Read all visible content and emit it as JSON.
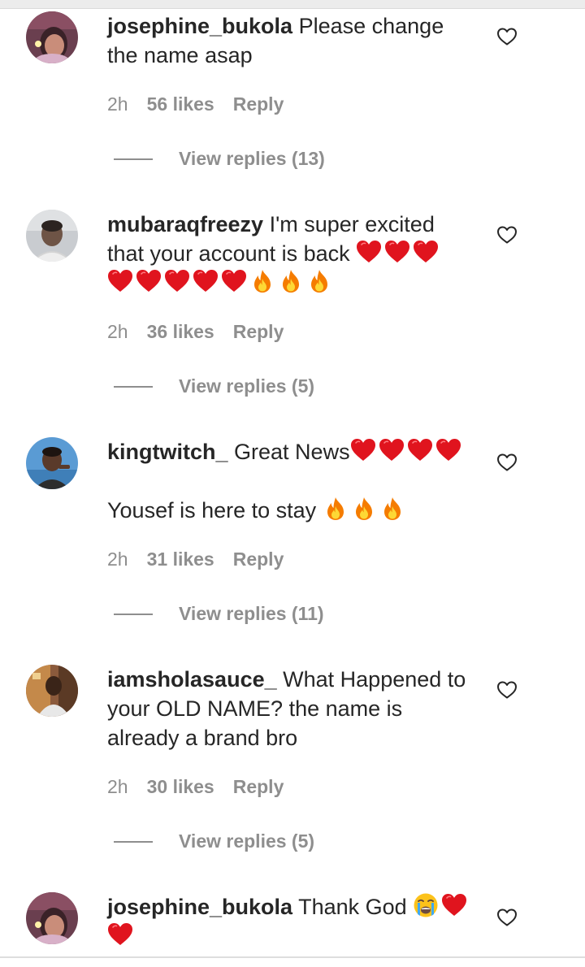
{
  "comments": [
    {
      "username": "josephine_bukola",
      "text": "Please change the name asap",
      "time": "2h",
      "likes": "56 likes",
      "reply_label": "Reply",
      "view_replies": "View replies (13)"
    },
    {
      "username": "mubaraqfreezy",
      "text": "I'm super excited that your account is back",
      "emoji_sequence": [
        "red-heart",
        "red-heart",
        "red-heart",
        "red-heart",
        "red-heart",
        "red-heart",
        "red-heart",
        "red-heart",
        "fire",
        "fire",
        "fire"
      ],
      "time": "2h",
      "likes": "36 likes",
      "reply_label": "Reply",
      "view_replies": "View replies (5)"
    },
    {
      "username": "kingtwitch_",
      "text": "Great News",
      "text_line2": "Yousef is here to stay",
      "emoji_sequence": [
        "red-heart",
        "red-heart",
        "red-heart",
        "red-heart"
      ],
      "emoji_sequence_line2": [
        "fire",
        "fire",
        "fire"
      ],
      "time": "2h",
      "likes": "31 likes",
      "reply_label": "Reply",
      "view_replies": "View replies (11)"
    },
    {
      "username": "iamsholasauce_",
      "text": "What Happened to your OLD NAME? the name is already a brand bro",
      "time": "2h",
      "likes": "30 likes",
      "reply_label": "Reply",
      "view_replies": "View replies (5)"
    },
    {
      "username": "josephine_bukola",
      "text": "Thank God",
      "emoji_sequence": [
        "loudly-crying-face",
        "red-heart",
        "red-heart"
      ]
    }
  ],
  "colors": {
    "text": "#262626",
    "secondary": "#8e8e8e",
    "heart": "#e0141e",
    "fire": "#f7a21b"
  },
  "icons": {
    "like": "heart-outline-icon",
    "emoji_heart": "red-heart",
    "emoji_fire": "fire",
    "emoji_cry": "loudly-crying-face"
  }
}
